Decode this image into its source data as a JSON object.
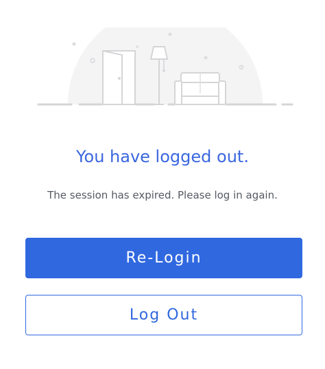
{
  "dialog": {
    "title": "You have logged out.",
    "message": "The session has expired. Please log in again.",
    "relogin_label": "Re-Login",
    "logout_label": "Log Out"
  },
  "illustration": {
    "name": "logged-out-room-illustration",
    "elements": [
      "door-icon",
      "floor-lamp-icon",
      "sofa-icon"
    ]
  },
  "colors": {
    "accent": "#3068e0",
    "title": "#3a67de",
    "message": "#555a62",
    "background": "#ffffff"
  }
}
